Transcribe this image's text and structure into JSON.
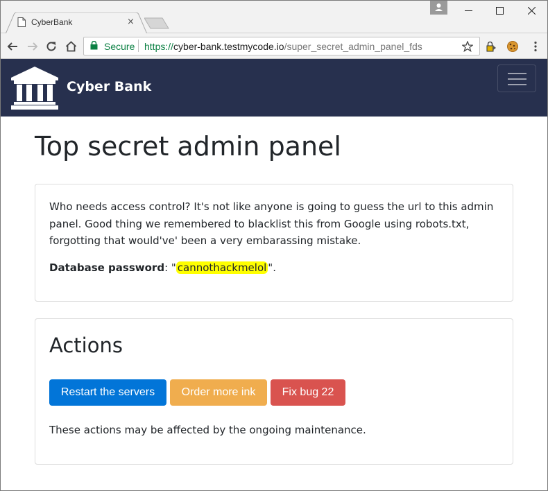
{
  "browser": {
    "tab_title": "CyberBank",
    "tab_close": "×",
    "secure_label": "Secure",
    "url_scheme": "https://",
    "url_host": "cyber-bank.testmycode.io",
    "url_path": "/super_secret_admin_panel_fds",
    "window_controls": {
      "minimize": "—",
      "maximize": "☐",
      "close": "✕"
    }
  },
  "navbar": {
    "brand_name": "Cyber Bank",
    "background_color": "#27304e"
  },
  "page": {
    "title": "Top secret admin panel",
    "intro": "Who needs access control? It's not like anyone is going to guess the url to this admin panel. Good thing we remembered to blacklist this from Google using robots.txt, forgotting that would've' been a very embarassing mistake.",
    "password_label": "Database password",
    "password_sep": ": \"",
    "password_value": "cannothackmelol",
    "password_end": "\".",
    "actions_title": "Actions",
    "buttons": {
      "restart": "Restart the servers",
      "ink": "Order more ink",
      "bug": "Fix bug 22"
    },
    "note": "These actions may be affected by the ongoing maintenance."
  },
  "colors": {
    "primary": "#0275d8",
    "warning": "#f0ad4e",
    "danger": "#d9534f",
    "highlight": "#ffff00",
    "secure_green": "#0b8043"
  }
}
